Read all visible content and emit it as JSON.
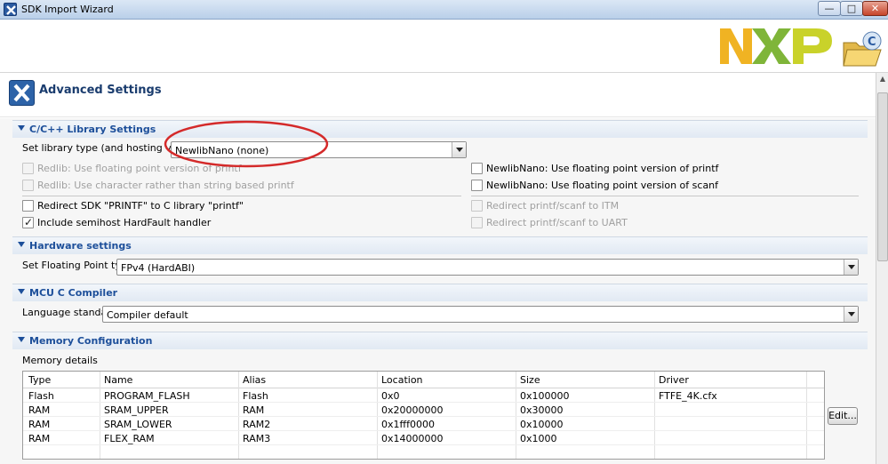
{
  "window": {
    "title": "SDK Import Wizard",
    "minimize_label": "—",
    "maximize_label": "□",
    "close_label": "✕"
  },
  "header": {
    "title": "Advanced Settings"
  },
  "colors": {
    "accent": "#1d4f9a",
    "annotation": "#d42a2a"
  },
  "library": {
    "section": "C/C++ Library Settings",
    "type_label": "Set library type (and hosting variant)",
    "type_value": "NewlibNano (none)",
    "redlib_float": "Redlib: Use floating point version of printf",
    "redlib_char": "Redlib: Use character rather than string based printf",
    "newlib_float_printf": "NewlibNano: Use floating point version of printf",
    "newlib_float_scanf": "NewlibNano: Use floating point version of scanf",
    "redirect_sdk": "Redirect SDK \"PRINTF\" to C library \"printf\"",
    "include_semihost": "Include semihost HardFault handler",
    "redirect_itm": "Redirect printf/scanf to ITM",
    "redirect_uart": "Redirect printf/scanf to UART",
    "checked_mark": "✓"
  },
  "hardware": {
    "section": "Hardware settings",
    "fp_label": "Set Floating Point type",
    "fp_value": "FPv4 (HardABI)"
  },
  "compiler": {
    "section": "MCU C Compiler",
    "lang_label": "Language standard",
    "lang_value": "Compiler default"
  },
  "memory": {
    "section": "Memory Configuration",
    "details_label": "Memory details",
    "columns": [
      "Type",
      "Name",
      "Alias",
      "Location",
      "Size",
      "Driver"
    ],
    "rows": [
      [
        "Flash",
        "PROGRAM_FLASH",
        "Flash",
        "0x0",
        "0x100000",
        "FTFE_4K.cfx"
      ],
      [
        "RAM",
        "SRAM_UPPER",
        "RAM",
        "0x20000000",
        "0x30000",
        ""
      ],
      [
        "RAM",
        "SRAM_LOWER",
        "RAM2",
        "0x1fff0000",
        "0x10000",
        ""
      ],
      [
        "RAM",
        "FLEX_RAM",
        "RAM3",
        "0x14000000",
        "0x1000",
        ""
      ]
    ],
    "edit_label": "Edit..."
  }
}
